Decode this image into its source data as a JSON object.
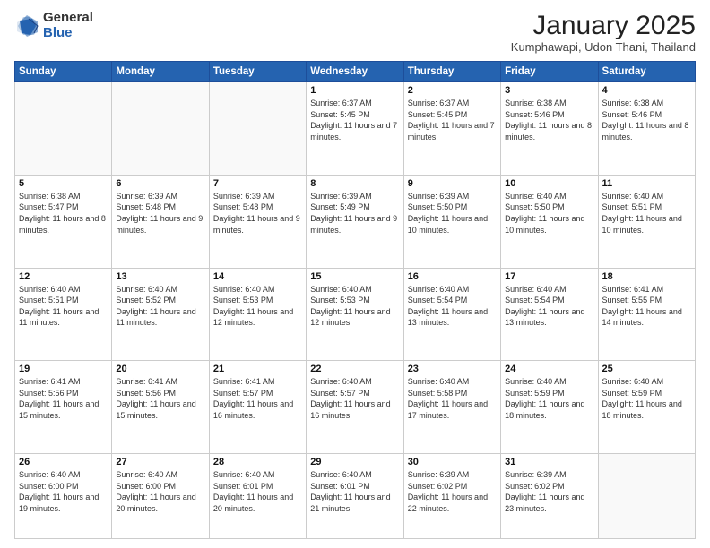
{
  "header": {
    "logo_general": "General",
    "logo_blue": "Blue",
    "title": "January 2025",
    "location": "Kumphawapi, Udon Thani, Thailand"
  },
  "days_of_week": [
    "Sunday",
    "Monday",
    "Tuesday",
    "Wednesday",
    "Thursday",
    "Friday",
    "Saturday"
  ],
  "weeks": [
    [
      {
        "day": "",
        "sunrise": "",
        "sunset": "",
        "daylight": ""
      },
      {
        "day": "",
        "sunrise": "",
        "sunset": "",
        "daylight": ""
      },
      {
        "day": "",
        "sunrise": "",
        "sunset": "",
        "daylight": ""
      },
      {
        "day": "1",
        "sunrise": "Sunrise: 6:37 AM",
        "sunset": "Sunset: 5:45 PM",
        "daylight": "Daylight: 11 hours and 7 minutes."
      },
      {
        "day": "2",
        "sunrise": "Sunrise: 6:37 AM",
        "sunset": "Sunset: 5:45 PM",
        "daylight": "Daylight: 11 hours and 7 minutes."
      },
      {
        "day": "3",
        "sunrise": "Sunrise: 6:38 AM",
        "sunset": "Sunset: 5:46 PM",
        "daylight": "Daylight: 11 hours and 8 minutes."
      },
      {
        "day": "4",
        "sunrise": "Sunrise: 6:38 AM",
        "sunset": "Sunset: 5:46 PM",
        "daylight": "Daylight: 11 hours and 8 minutes."
      }
    ],
    [
      {
        "day": "5",
        "sunrise": "Sunrise: 6:38 AM",
        "sunset": "Sunset: 5:47 PM",
        "daylight": "Daylight: 11 hours and 8 minutes."
      },
      {
        "day": "6",
        "sunrise": "Sunrise: 6:39 AM",
        "sunset": "Sunset: 5:48 PM",
        "daylight": "Daylight: 11 hours and 9 minutes."
      },
      {
        "day": "7",
        "sunrise": "Sunrise: 6:39 AM",
        "sunset": "Sunset: 5:48 PM",
        "daylight": "Daylight: 11 hours and 9 minutes."
      },
      {
        "day": "8",
        "sunrise": "Sunrise: 6:39 AM",
        "sunset": "Sunset: 5:49 PM",
        "daylight": "Daylight: 11 hours and 9 minutes."
      },
      {
        "day": "9",
        "sunrise": "Sunrise: 6:39 AM",
        "sunset": "Sunset: 5:50 PM",
        "daylight": "Daylight: 11 hours and 10 minutes."
      },
      {
        "day": "10",
        "sunrise": "Sunrise: 6:40 AM",
        "sunset": "Sunset: 5:50 PM",
        "daylight": "Daylight: 11 hours and 10 minutes."
      },
      {
        "day": "11",
        "sunrise": "Sunrise: 6:40 AM",
        "sunset": "Sunset: 5:51 PM",
        "daylight": "Daylight: 11 hours and 10 minutes."
      }
    ],
    [
      {
        "day": "12",
        "sunrise": "Sunrise: 6:40 AM",
        "sunset": "Sunset: 5:51 PM",
        "daylight": "Daylight: 11 hours and 11 minutes."
      },
      {
        "day": "13",
        "sunrise": "Sunrise: 6:40 AM",
        "sunset": "Sunset: 5:52 PM",
        "daylight": "Daylight: 11 hours and 11 minutes."
      },
      {
        "day": "14",
        "sunrise": "Sunrise: 6:40 AM",
        "sunset": "Sunset: 5:53 PM",
        "daylight": "Daylight: 11 hours and 12 minutes."
      },
      {
        "day": "15",
        "sunrise": "Sunrise: 6:40 AM",
        "sunset": "Sunset: 5:53 PM",
        "daylight": "Daylight: 11 hours and 12 minutes."
      },
      {
        "day": "16",
        "sunrise": "Sunrise: 6:40 AM",
        "sunset": "Sunset: 5:54 PM",
        "daylight": "Daylight: 11 hours and 13 minutes."
      },
      {
        "day": "17",
        "sunrise": "Sunrise: 6:40 AM",
        "sunset": "Sunset: 5:54 PM",
        "daylight": "Daylight: 11 hours and 13 minutes."
      },
      {
        "day": "18",
        "sunrise": "Sunrise: 6:41 AM",
        "sunset": "Sunset: 5:55 PM",
        "daylight": "Daylight: 11 hours and 14 minutes."
      }
    ],
    [
      {
        "day": "19",
        "sunrise": "Sunrise: 6:41 AM",
        "sunset": "Sunset: 5:56 PM",
        "daylight": "Daylight: 11 hours and 15 minutes."
      },
      {
        "day": "20",
        "sunrise": "Sunrise: 6:41 AM",
        "sunset": "Sunset: 5:56 PM",
        "daylight": "Daylight: 11 hours and 15 minutes."
      },
      {
        "day": "21",
        "sunrise": "Sunrise: 6:41 AM",
        "sunset": "Sunset: 5:57 PM",
        "daylight": "Daylight: 11 hours and 16 minutes."
      },
      {
        "day": "22",
        "sunrise": "Sunrise: 6:40 AM",
        "sunset": "Sunset: 5:57 PM",
        "daylight": "Daylight: 11 hours and 16 minutes."
      },
      {
        "day": "23",
        "sunrise": "Sunrise: 6:40 AM",
        "sunset": "Sunset: 5:58 PM",
        "daylight": "Daylight: 11 hours and 17 minutes."
      },
      {
        "day": "24",
        "sunrise": "Sunrise: 6:40 AM",
        "sunset": "Sunset: 5:59 PM",
        "daylight": "Daylight: 11 hours and 18 minutes."
      },
      {
        "day": "25",
        "sunrise": "Sunrise: 6:40 AM",
        "sunset": "Sunset: 5:59 PM",
        "daylight": "Daylight: 11 hours and 18 minutes."
      }
    ],
    [
      {
        "day": "26",
        "sunrise": "Sunrise: 6:40 AM",
        "sunset": "Sunset: 6:00 PM",
        "daylight": "Daylight: 11 hours and 19 minutes."
      },
      {
        "day": "27",
        "sunrise": "Sunrise: 6:40 AM",
        "sunset": "Sunset: 6:00 PM",
        "daylight": "Daylight: 11 hours and 20 minutes."
      },
      {
        "day": "28",
        "sunrise": "Sunrise: 6:40 AM",
        "sunset": "Sunset: 6:01 PM",
        "daylight": "Daylight: 11 hours and 20 minutes."
      },
      {
        "day": "29",
        "sunrise": "Sunrise: 6:40 AM",
        "sunset": "Sunset: 6:01 PM",
        "daylight": "Daylight: 11 hours and 21 minutes."
      },
      {
        "day": "30",
        "sunrise": "Sunrise: 6:39 AM",
        "sunset": "Sunset: 6:02 PM",
        "daylight": "Daylight: 11 hours and 22 minutes."
      },
      {
        "day": "31",
        "sunrise": "Sunrise: 6:39 AM",
        "sunset": "Sunset: 6:02 PM",
        "daylight": "Daylight: 11 hours and 23 minutes."
      },
      {
        "day": "",
        "sunrise": "",
        "sunset": "",
        "daylight": ""
      }
    ]
  ]
}
